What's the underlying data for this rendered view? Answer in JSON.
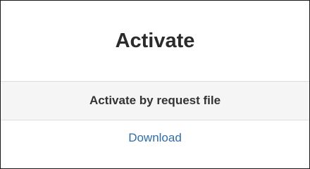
{
  "page": {
    "title": "Activate"
  },
  "activation_table": {
    "header": "Activate by request file",
    "link_label": "Download"
  },
  "colors": {
    "title_text": "#2b2b2b",
    "header_background": "#f5f5f5",
    "link": "#2f6ea8",
    "border": "#1a1a1a"
  }
}
